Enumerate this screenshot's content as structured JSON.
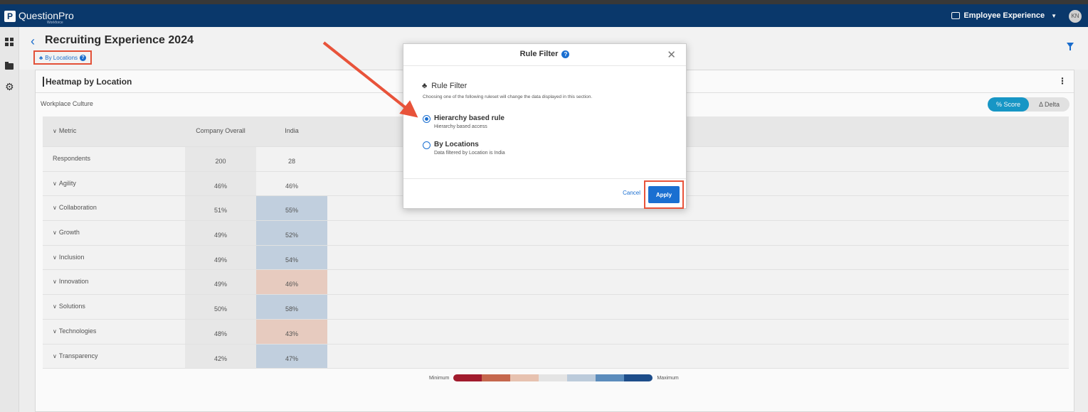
{
  "brand": {
    "name": "QuestionPro",
    "sub": "Workforce"
  },
  "product_menu": "Employee Experience",
  "user_initials": "KN",
  "page": {
    "title": "Recruiting Experience 2024",
    "ruleset_label": "By Locations"
  },
  "card": {
    "title": "Heatmap by Location",
    "section_label": "Workplace Culture",
    "toggle": {
      "active": "% Score",
      "inactive": "Δ Delta"
    }
  },
  "heatmap": {
    "columns": [
      "Metric",
      "Company Overall",
      "India"
    ],
    "rows": [
      {
        "metric": "Respondents",
        "overall": "200",
        "india": "28",
        "color": ""
      },
      {
        "metric": "Agility",
        "overall": "46%",
        "india": "46%",
        "color": ""
      },
      {
        "metric": "Collaboration",
        "overall": "51%",
        "india": "55%",
        "color": "#c5d4e3"
      },
      {
        "metric": "Growth",
        "overall": "49%",
        "india": "52%",
        "color": "#c5d4e3"
      },
      {
        "metric": "Inclusion",
        "overall": "49%",
        "india": "54%",
        "color": "#c5d4e3"
      },
      {
        "metric": "Innovation",
        "overall": "49%",
        "india": "46%",
        "color": "#ecd0c3"
      },
      {
        "metric": "Solutions",
        "overall": "50%",
        "india": "58%",
        "color": "#c5d4e3"
      },
      {
        "metric": "Technologies",
        "overall": "48%",
        "india": "43%",
        "color": "#ecd0c3"
      },
      {
        "metric": "Transparency",
        "overall": "42%",
        "india": "47%",
        "color": "#c5d4e3"
      }
    ]
  },
  "legend": {
    "min_label": "Minimum",
    "max_label": "Maximum",
    "colors": [
      "#a51c2e",
      "#c96a4f",
      "#ecc6b4",
      "#e9e9e9",
      "#c0d0e0",
      "#5d8fc0",
      "#1e4f8d"
    ]
  },
  "modal": {
    "title": "Rule Filter",
    "subtitle": "Rule Filter",
    "description": "Choosing one of the following ruleset will change the data displayed in this section.",
    "options": [
      {
        "label": "Hierarchy based rule",
        "desc": "Hierarchy based access",
        "selected": true
      },
      {
        "label": "By Locations",
        "desc": "Data filtered by Location is India",
        "selected": false
      }
    ],
    "cancel": "Cancel",
    "apply": "Apply"
  },
  "colors": {
    "nav": "#0b3a6e",
    "accent": "#1a6fd1",
    "highlight": "#e8533a",
    "toggle_on": "#1899c9"
  }
}
